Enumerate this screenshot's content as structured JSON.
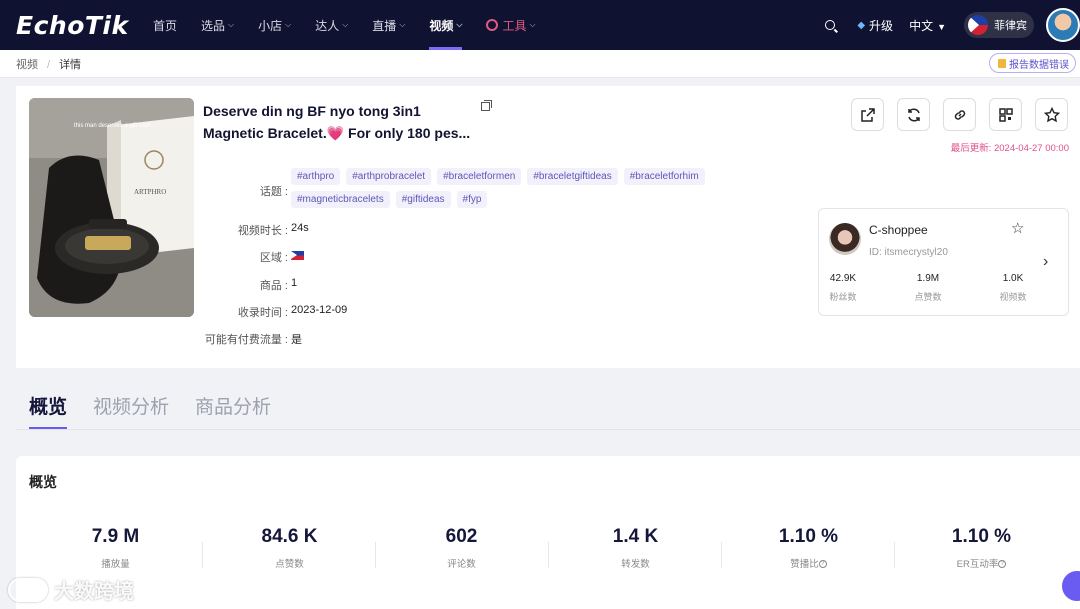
{
  "brand": "EchoTik",
  "nav": {
    "items": [
      {
        "label": "首页",
        "caret": false
      },
      {
        "label": "选品",
        "caret": true
      },
      {
        "label": "小店",
        "caret": true
      },
      {
        "label": "达人",
        "caret": true
      },
      {
        "label": "直播",
        "caret": true
      },
      {
        "label": "视频",
        "caret": true,
        "active": true
      },
      {
        "label": "工具",
        "caret": true,
        "tool": true
      }
    ],
    "upgrade": "升级",
    "language": "中文",
    "region": "菲律宾"
  },
  "breadcrumb": {
    "parent": "视频",
    "current": "详情"
  },
  "report_error": "报告数据错误",
  "video": {
    "title": "Deserve din ng BF nyo tong 3in1 Magnetic Bracelet.💗 For only 180 pes...",
    "labels": {
      "topics": "话题 :",
      "duration": "视频时长 :",
      "region": "区域 :",
      "products": "商品 :",
      "collected": "收录时间 :",
      "paid": "可能有付费流量 :"
    },
    "tags": [
      "#arthpro",
      "#arthprobracelet",
      "#braceletformen",
      "#braceletgiftideas",
      "#braceletforhim",
      "#magneticbracelets",
      "#giftideas",
      "#fyp"
    ],
    "duration": "24s",
    "products": "1",
    "collected": "2023-12-09",
    "paid": "是",
    "updated": "最后更新: 2024-04-27 00:00",
    "thumb_caption": "this man deserves a gift too!!",
    "thumb_brand": "ARTPHRO"
  },
  "creator": {
    "name": "C-shoppee",
    "id": "ID: itsmecrystyl20",
    "stats": [
      {
        "value": "42.9K",
        "label": "粉丝数"
      },
      {
        "value": "1.9M",
        "label": "点赞数"
      },
      {
        "value": "1.0K",
        "label": "视频数"
      }
    ]
  },
  "tabs": [
    "概览",
    "视频分析",
    "商品分析"
  ],
  "overview": {
    "title": "概览",
    "metrics": [
      {
        "value": "7.9 M",
        "label": "播放量"
      },
      {
        "value": "84.6 K",
        "label": "点赞数"
      },
      {
        "value": "602",
        "label": "评论数"
      },
      {
        "value": "1.4 K",
        "label": "转发数"
      },
      {
        "value": "1.10 %",
        "label": "赞播比"
      },
      {
        "value": "1.10 %",
        "label": "ER互动率"
      }
    ]
  },
  "watermark": "大数跨境",
  "colors": {
    "nav_bg": "#101231",
    "accent": "#6b5cf0",
    "updated": "#e0508a"
  }
}
